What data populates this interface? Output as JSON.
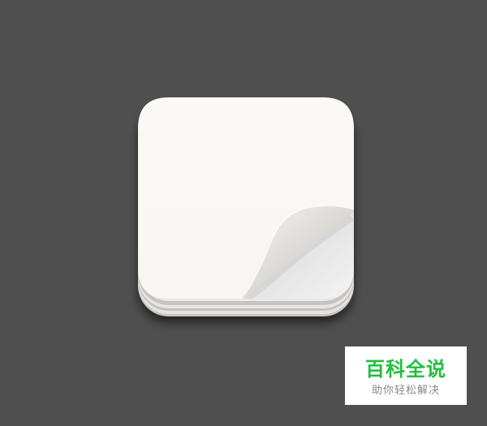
{
  "canvas": {
    "background_color": "#4f4f4f"
  },
  "icon": {
    "name": "notepad-page-curl-icon",
    "paper_color": "#fbf9f6",
    "curl_color": "#ededec",
    "stack_color": "#e3e2e0"
  },
  "watermark": {
    "title": "百科全说",
    "subtitle": "助你轻松解决",
    "title_color": "#22bf3a",
    "subtitle_color": "#8a8a8a"
  }
}
